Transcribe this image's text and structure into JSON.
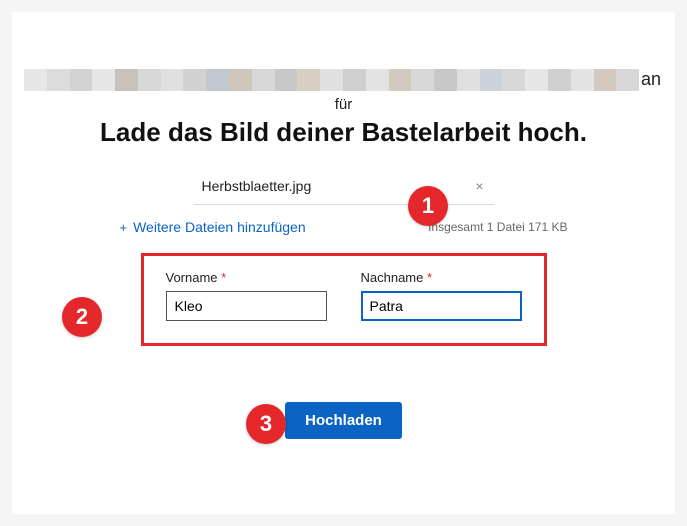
{
  "header": {
    "stripe_end": "an",
    "sub": "für",
    "title": "Lade das Bild deiner Bastelarbeit hoch."
  },
  "file": {
    "name": "Herbstblaetter.jpg",
    "totals": "Insgesamt 1 Datei  171 KB"
  },
  "actions": {
    "add_more": "Weitere Dateien hinzufügen",
    "upload": "Hochladen"
  },
  "form": {
    "vorname_label": "Vorname",
    "nachname_label": "Nachname",
    "required_mark": "*",
    "vorname_value": "Kleo",
    "nachname_value": "Patra"
  },
  "callouts": {
    "c1": "1",
    "c2": "2",
    "c3": "3"
  },
  "stripe_colors": [
    "#e7e7e7",
    "#dcdcdc",
    "#d3d3d3",
    "#e7e7e7",
    "#c9c2bb",
    "#d8d8d8",
    "#e0e0e0",
    "#d2d2d2",
    "#c2c8d0",
    "#d0c7bc",
    "#d8d8d8",
    "#c8c8c8",
    "#d8cfc4",
    "#e0e0e0",
    "#cfcfcf",
    "#e3e3e3",
    "#d3c9be",
    "#d8d8d8",
    "#c8c8c8",
    "#e0e0e0",
    "#cbd2da",
    "#d8d8d8",
    "#e7e7e7",
    "#d0d0d0",
    "#e3e3e3",
    "#d3c9be",
    "#d8d8d8"
  ]
}
